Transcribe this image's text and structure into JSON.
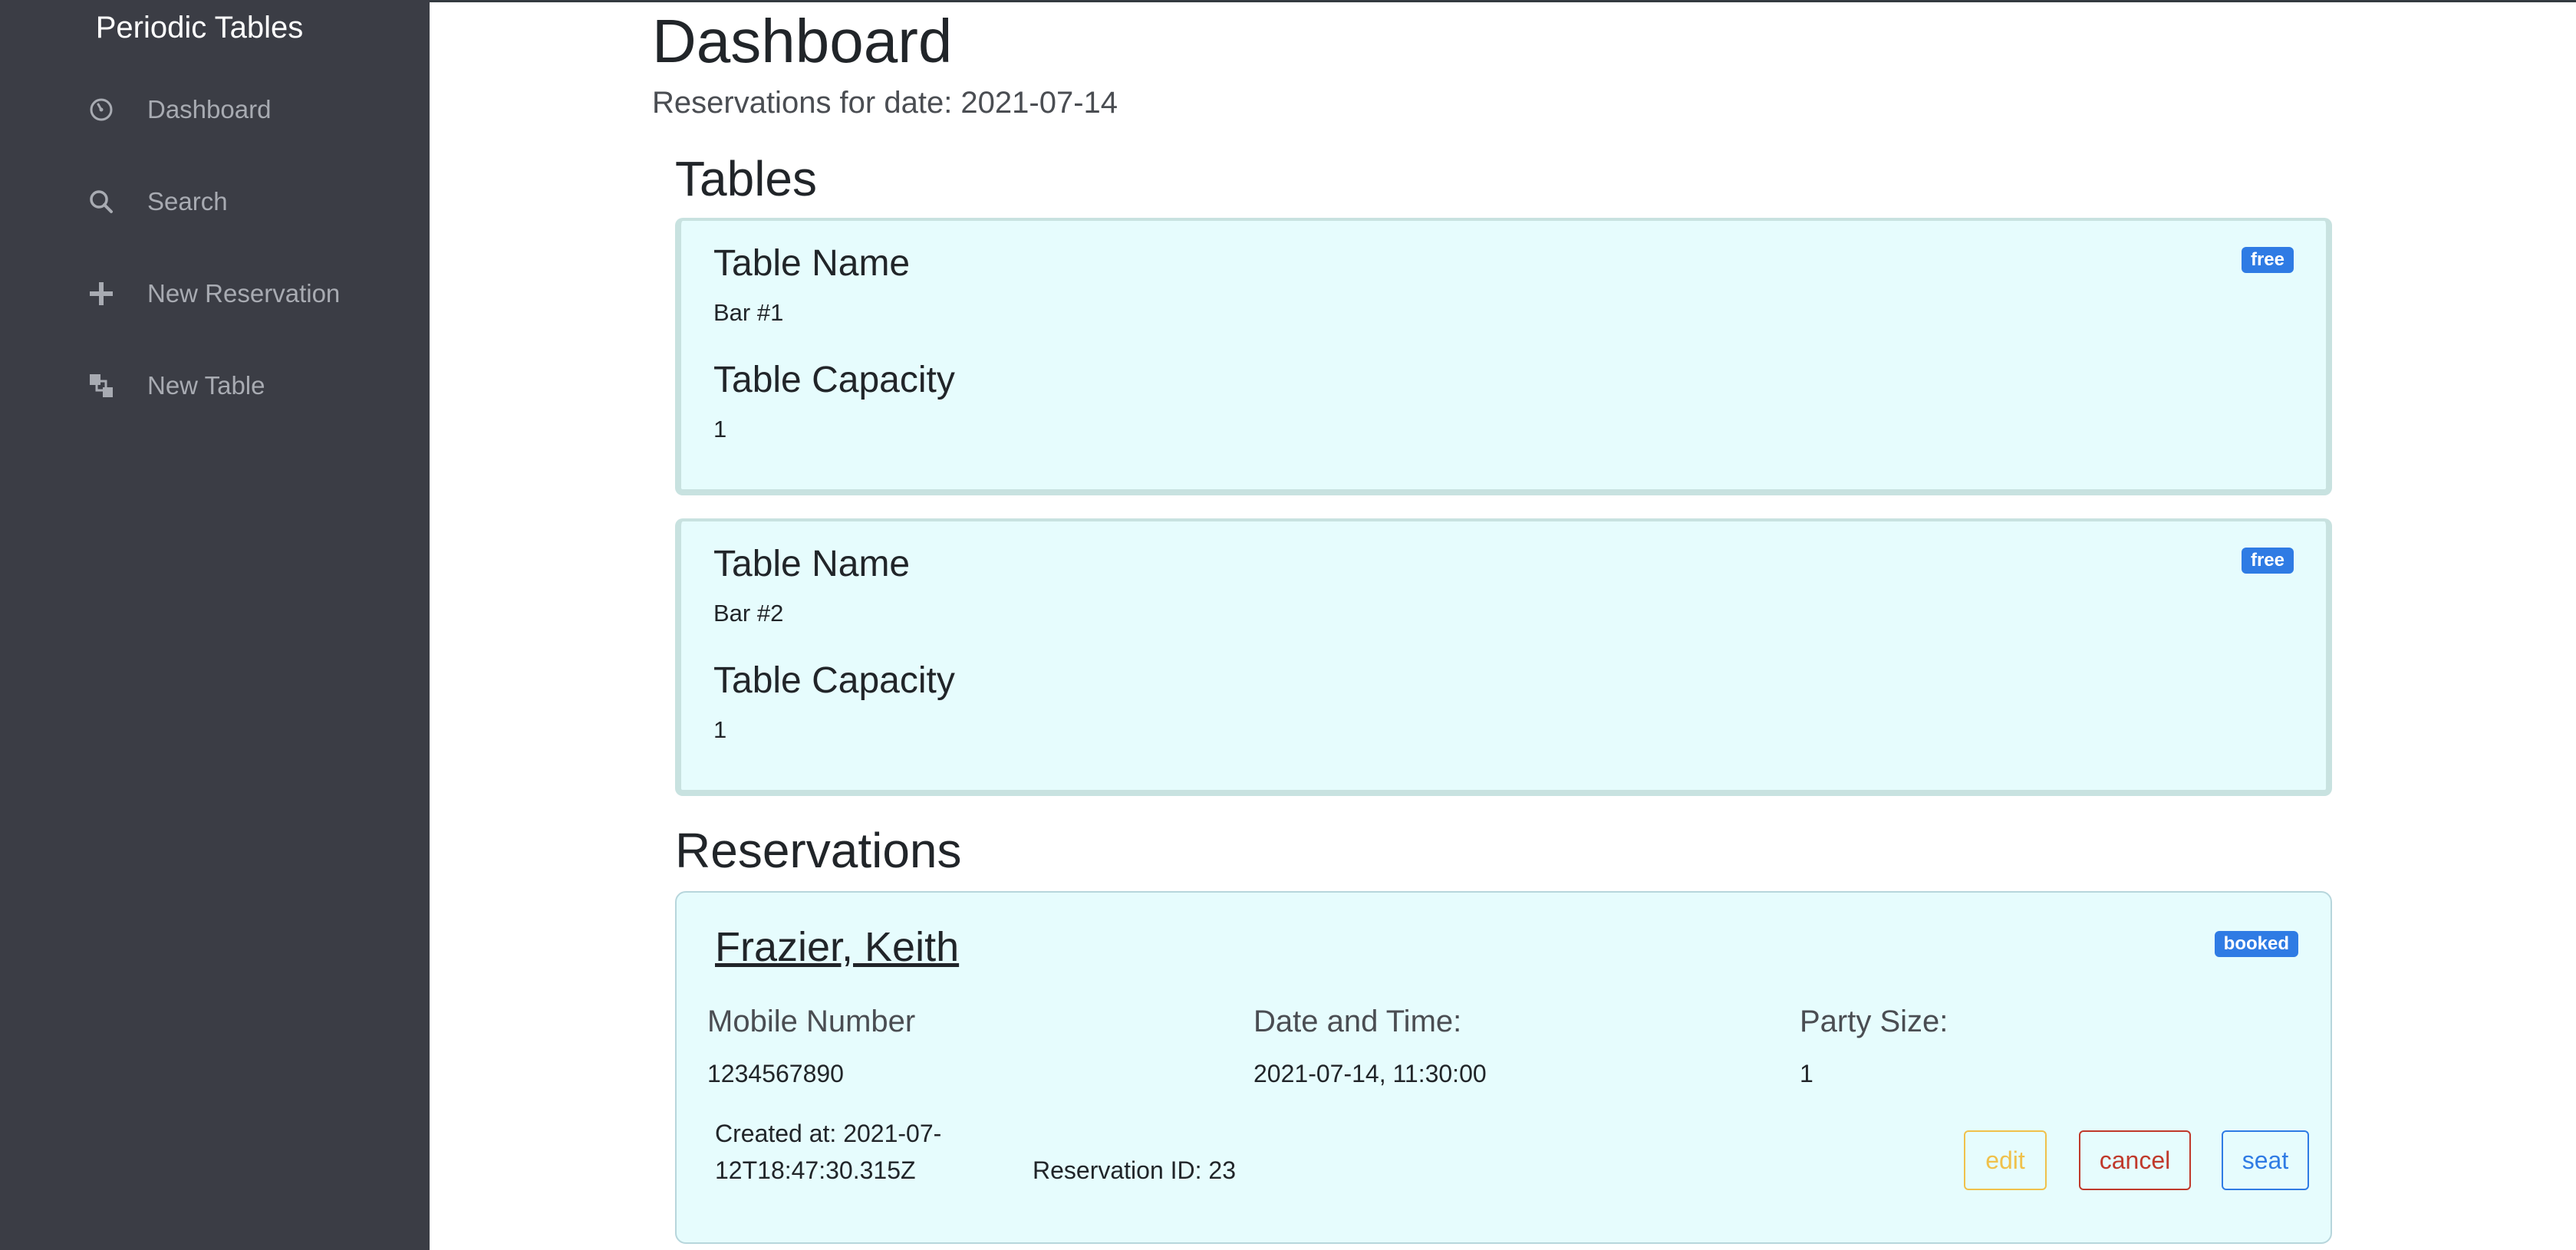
{
  "sidebar": {
    "brand": "Periodic Tables",
    "items": [
      {
        "label": "Dashboard",
        "icon": "dashboard-icon"
      },
      {
        "label": "Search",
        "icon": "search-icon"
      },
      {
        "label": "New Reservation",
        "icon": "plus-icon"
      },
      {
        "label": "New Table",
        "icon": "layers-icon"
      }
    ]
  },
  "header": {
    "title": "Dashboard",
    "subtitle": "Reservations for date: 2021-07-14"
  },
  "tables_section": {
    "heading": "Tables",
    "name_label": "Table Name",
    "capacity_label": "Table Capacity",
    "items": [
      {
        "name": "Bar #1",
        "capacity": "1",
        "status": "free"
      },
      {
        "name": "Bar #2",
        "capacity": "1",
        "status": "free"
      }
    ]
  },
  "reservations_section": {
    "heading": "Reservations",
    "items": [
      {
        "name": "Frazier, Keith",
        "status": "booked",
        "mobile_label": "Mobile Number",
        "mobile": "1234567890",
        "datetime_label": "Date and Time:",
        "datetime": "2021-07-14, 11:30:00",
        "party_label": "Party Size:",
        "party_size": "1",
        "created_line1": "Created at: 2021-07-",
        "created_line2": "12T18:47:30.315Z",
        "reservation_id": "Reservation ID: 23",
        "buttons": {
          "edit": "edit",
          "cancel": "cancel",
          "seat": "seat"
        }
      }
    ]
  },
  "colors": {
    "sidebar_bg": "#3b3d45",
    "card_bg": "#e6fcfd",
    "badge": "#2f7be4",
    "edit": "#f0c14b",
    "cancel": "#c0392b",
    "seat": "#2f7be4"
  }
}
